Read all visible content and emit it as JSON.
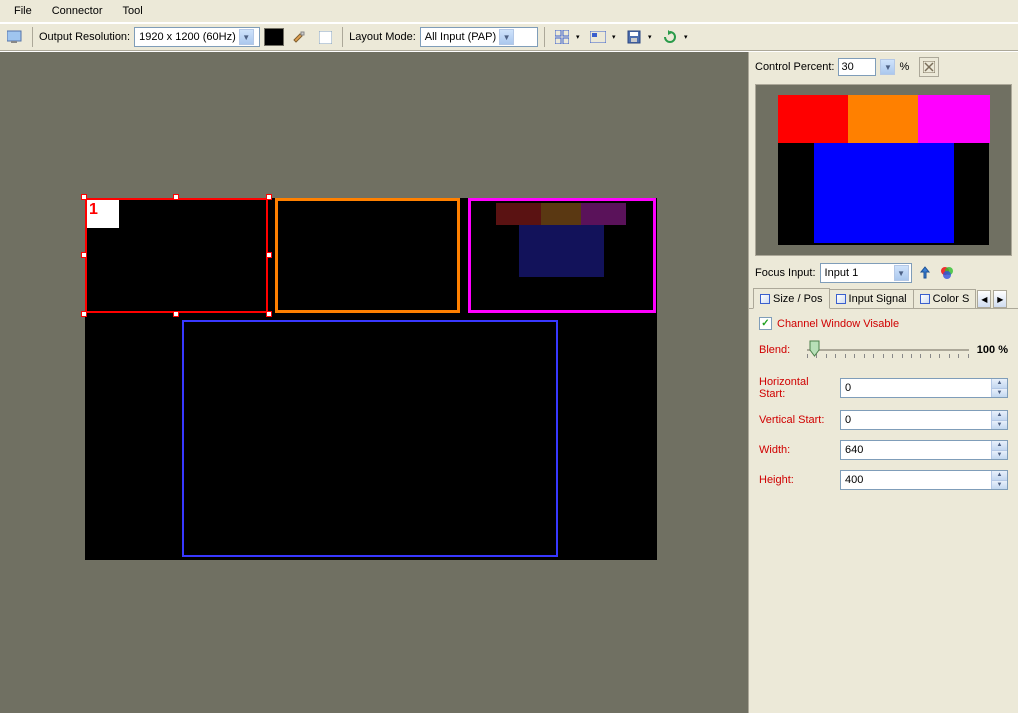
{
  "menu": {
    "file": "File",
    "connector": "Connector",
    "tool": "Tool"
  },
  "toolbar": {
    "output_res_label": "Output Resolution:",
    "output_res_value": "1920 x 1200 (60Hz)",
    "layout_mode_label": "Layout Mode:",
    "layout_mode_value": "All Input (PAP)"
  },
  "canvas": {
    "win1_label": "1"
  },
  "panel": {
    "control_percent_label": "Control Percent:",
    "control_percent_value": "30",
    "percent_sign": "%",
    "focus_input_label": "Focus Input:",
    "focus_input_value": "Input 1",
    "tabs": {
      "sizepos": "Size / Pos",
      "inputsignal": "Input Signal",
      "colors": "Color S"
    },
    "channel_window_visible": "Channel Window Visable",
    "blend_label": "Blend:",
    "blend_value": "100 %",
    "hstart_label": "Horizontal Start:",
    "hstart_value": "0",
    "vstart_label": "Vertical Start:",
    "vstart_value": "0",
    "width_label": "Width:",
    "width_value": "640",
    "height_label": "Height:",
    "height_value": "400"
  }
}
